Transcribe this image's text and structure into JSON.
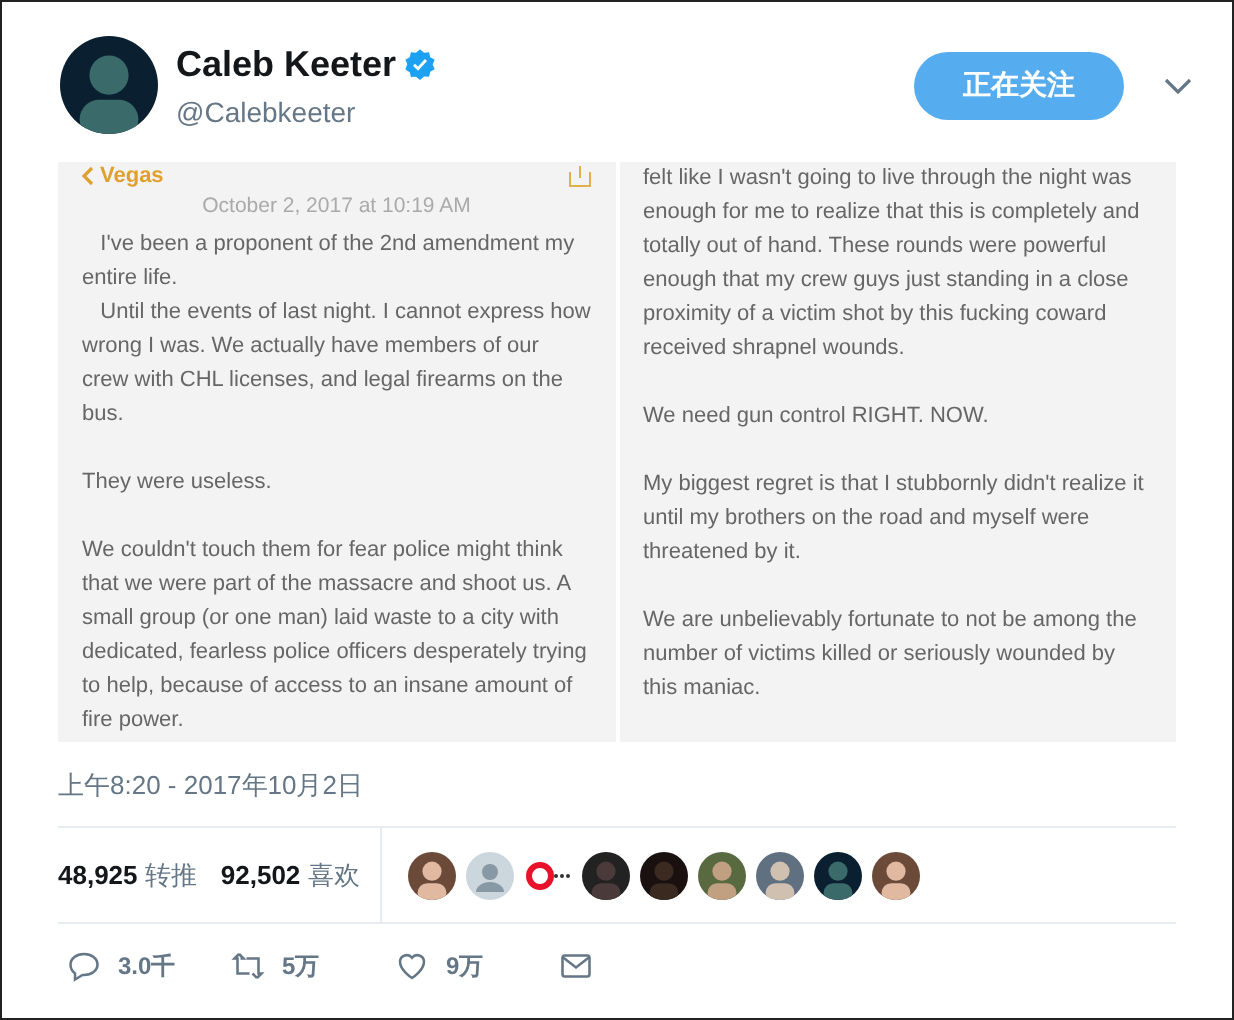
{
  "author": {
    "name": "Caleb Keeter",
    "verified": true,
    "handle": "@Calebkeeter"
  },
  "follow_button": {
    "label": "正在关注"
  },
  "note_images": [
    {
      "back_label": "Vegas",
      "date": "October 2, 2017 at 10:19 AM",
      "paragraphs": [
        "   I've been a proponent of the 2nd amendment my entire life.\n   Until the events of last night. I cannot express how wrong I was. We actually have members of our crew with CHL licenses, and legal firearms on the bus.",
        "They were useless.",
        "We couldn't touch them for fear police might think that we were part of the massacre and shoot us. A small group (or one man) laid waste to a city with dedicated, fearless police officers desperately trying to help, because of access to an insane amount of fire power."
      ]
    },
    {
      "paragraphs": [
        "felt like I wasn't going to live through the night was enough for me to realize that this is completely and totally out of hand. These rounds were powerful enough that my crew guys just standing in a close proximity of a victim shot by this fucking coward received shrapnel wounds.",
        "We need gun control RIGHT. NOW.",
        "My biggest regret is that I stubbornly didn't realize it until my brothers on the road and myself were threatened by it.",
        "We are unbelievably fortunate to not be among the number of victims killed or seriously wounded by this maniac."
      ]
    }
  ],
  "timestamp": "上午8:20 - 2017年10月2日",
  "stats": [
    {
      "count": "48,925",
      "label": "转推"
    },
    {
      "count": "92,502",
      "label": "喜欢"
    }
  ],
  "likers": [
    {
      "kind": "picture"
    },
    {
      "kind": "default"
    },
    {
      "kind": "logo"
    },
    {
      "kind": "picture"
    },
    {
      "kind": "picture"
    },
    {
      "kind": "picture"
    },
    {
      "kind": "picture"
    },
    {
      "kind": "picture"
    },
    {
      "kind": "picture"
    }
  ],
  "actions": [
    {
      "kind": "reply",
      "count": "3.0千"
    },
    {
      "kind": "retweet",
      "count": "5万"
    },
    {
      "kind": "like",
      "count": "9万"
    },
    {
      "kind": "message"
    }
  ]
}
